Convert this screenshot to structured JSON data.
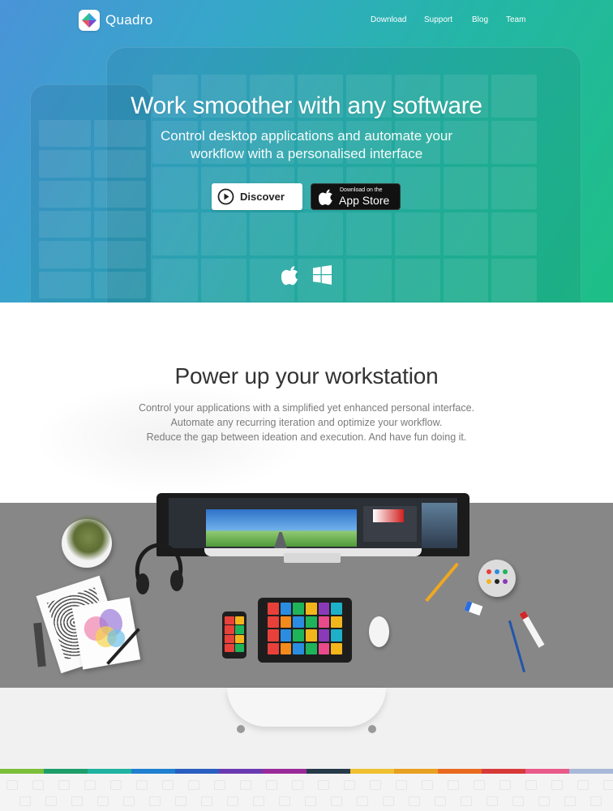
{
  "brand": {
    "name": "Quadro"
  },
  "nav": {
    "items": [
      "Download",
      "Support",
      "Blog",
      "Team"
    ]
  },
  "hero": {
    "title": "Work smoother with any software",
    "subtitle_line1": "Control desktop applications and automate your",
    "subtitle_line2": "workflow with a personalised interface",
    "discover_label": "Discover",
    "appstore_small": "Download on the",
    "appstore_big": "App Store",
    "platform_icons": [
      "apple-icon",
      "windows-icon"
    ]
  },
  "section2": {
    "title": "Power up your workstation",
    "lines": [
      "Control your applications with a simplified yet enhanced personal interface.",
      "Automate any recurring iteration and optimize your workflow.",
      "Reduce the gap between ideation and execution. And have fun doing it."
    ]
  },
  "colors": {
    "hero_gradient": [
      "#4a93d8",
      "#1ebf86"
    ],
    "stripe": [
      "#7cbf3a",
      "#1e9e6a",
      "#1fb2a0",
      "#1f7fd0",
      "#2a5ec0",
      "#6a3ab0",
      "#9a2a9a",
      "#263a4a",
      "#f0c030",
      "#e8a020",
      "#e86a20",
      "#d83a3a",
      "#e85a8a",
      "#a8b8d8"
    ]
  }
}
